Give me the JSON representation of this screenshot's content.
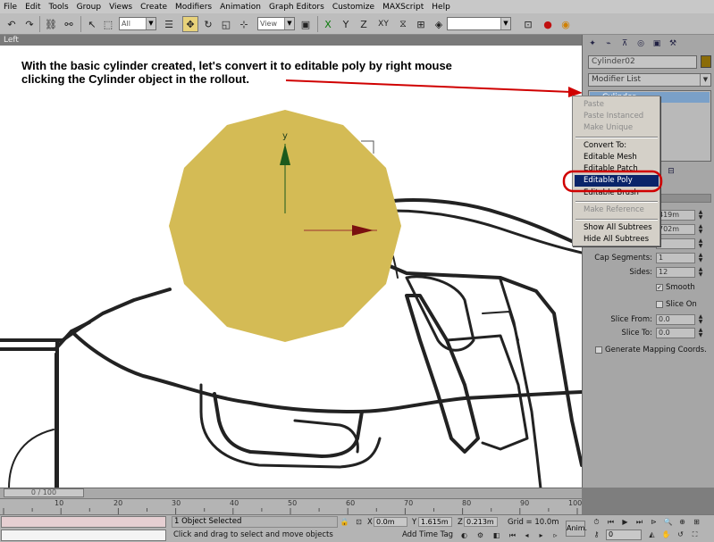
{
  "menu": [
    "File",
    "Edit",
    "Tools",
    "Group",
    "Views",
    "Create",
    "Modifiers",
    "Animation",
    "Graph Editors",
    "Customize",
    "MAXScript",
    "Help"
  ],
  "toolbar": {
    "selection_filter": "All",
    "ref_coord": "View",
    "named_selection": "",
    "icons": [
      "undo-icon",
      "redo-icon",
      "link-icon",
      "unlink-icon",
      "bind-space-warp-icon",
      "select-icon",
      "select-region-icon",
      "select-by-name-icon",
      "select-move-icon",
      "select-rotate-icon",
      "select-scale-icon",
      "mirror-icon",
      "align-icon",
      "render-icon",
      "teapot-icon"
    ],
    "axis_constraints": [
      "X",
      "Y",
      "Z",
      "XY"
    ]
  },
  "viewport": {
    "label": "Left",
    "annotation_line1": "With the basic cylinder created, let's convert it to editable poly by right mouse",
    "annotation_line2": "clicking the Cylinder object in the rollout.",
    "gizmo_y_label": "y",
    "object_color": "#d4bb55",
    "annotation_arrow_color": "#d00000"
  },
  "command_panel": {
    "object_name": "Cylinder02",
    "object_color": "#8b6c08",
    "modifier_list": "Modifier List",
    "stack_item": "Cylinder",
    "params": [
      {
        "label": "",
        "value": "419m"
      },
      {
        "label": "",
        "value": "702m"
      },
      {
        "label": "",
        "value": ""
      },
      {
        "label": "Cap Segments:",
        "value": "1"
      },
      {
        "label": "Sides:",
        "value": "12"
      }
    ],
    "smooth_label": "Smooth",
    "smooth_checked": true,
    "slice_on_label": "Slice On",
    "slice_from_label": "Slice From:",
    "slice_from_value": "0.0",
    "slice_to_label": "Slice To:",
    "slice_to_value": "0.0",
    "gen_mapping_label": "Generate Mapping Coords."
  },
  "context_menu": {
    "items": [
      {
        "label": "Paste",
        "disabled": true
      },
      {
        "label": "Paste Instanced",
        "disabled": true
      },
      {
        "label": "Make Unique",
        "disabled": true
      },
      {
        "label": "Convert To:",
        "disabled": false
      },
      {
        "label": "Editable Mesh",
        "disabled": false
      },
      {
        "label": "Editable Patch",
        "disabled": false
      },
      {
        "label": "Editable Poly",
        "disabled": false,
        "highlighted": true
      },
      {
        "label": "Editable Brush",
        "disabled": false
      },
      {
        "label": "Make Reference",
        "disabled": true
      },
      {
        "label": "Show All Subtrees",
        "disabled": false
      },
      {
        "label": "Hide All Subtrees",
        "disabled": false
      }
    ]
  },
  "timeline": {
    "slider": "0 / 100",
    "ticks": [
      "10",
      "20",
      "30",
      "40",
      "50",
      "60",
      "70",
      "80",
      "90",
      "100"
    ]
  },
  "status": {
    "selection": "1 Object Selected",
    "prompt": "Click and drag to select and move objects",
    "x_label": "X",
    "x_value": "0.0m",
    "y_label": "Y",
    "y_value": "1.615m",
    "z_label": "Z",
    "z_value": "0.213m",
    "grid": "Grid = 10.0m",
    "add_time_tag": "Add Time Tag",
    "anim": "Anim.",
    "frame": "0"
  }
}
